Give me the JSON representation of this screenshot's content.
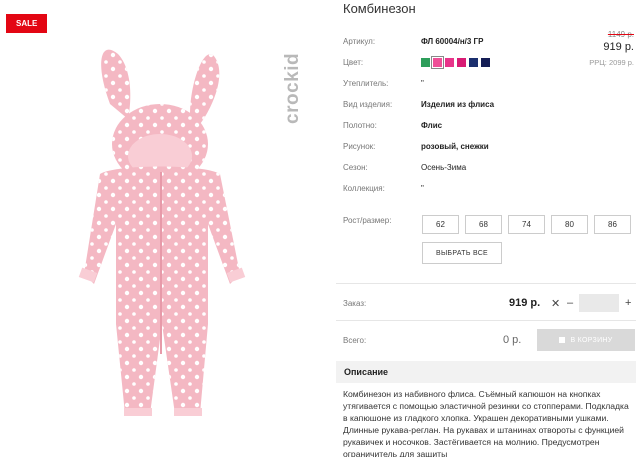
{
  "gallery": {
    "sale_badge": "SALE",
    "brand_logo_text": "crockid"
  },
  "product": {
    "title": "Комбинезон",
    "old_price": "1149 р.",
    "price": "919 р.",
    "rrp": "РРЦ: 2099 р."
  },
  "attributes": [
    {
      "label": "Артикул:",
      "value": "ФЛ 60004/н/3 ГР"
    },
    {
      "label": "Цвет:",
      "value": ""
    },
    {
      "label": "Утеплитель:",
      "value": "\""
    },
    {
      "label": "Вид изделия:",
      "value": "Изделия из флиса"
    },
    {
      "label": "Полотно:",
      "value": "Флис"
    },
    {
      "label": "Рисунок:",
      "value": "розовый, снежки"
    },
    {
      "label": "Сезон:",
      "value": "Осень-Зима"
    },
    {
      "label": "Коллекция:",
      "value": "\""
    }
  ],
  "colors": [
    {
      "name": "green",
      "hex": "#2e9e5b"
    },
    {
      "name": "pink-selected",
      "hex": "#ee4f97"
    },
    {
      "name": "pink",
      "hex": "#e8348a"
    },
    {
      "name": "magenta",
      "hex": "#d81b74"
    },
    {
      "name": "navy",
      "hex": "#1b2f6e"
    },
    {
      "name": "dark-navy",
      "hex": "#141d55"
    }
  ],
  "sizes": {
    "label": "Рост/размер:",
    "options": [
      "62",
      "68",
      "74",
      "80",
      "86"
    ],
    "select_all": "ВЫБРАТЬ ВСЕ"
  },
  "order": {
    "label": "Заказ:",
    "price": "919 р.",
    "remove": "✕",
    "minus": "–",
    "plus": "+"
  },
  "total": {
    "label": "Всего:",
    "price": "0 р.",
    "cart_button": "В КОРЗИНУ"
  },
  "description": {
    "heading": "Описание",
    "text": "Комбинезон из набивного флиса. Съёмный капюшон на кнопках утягивается с помощью эластичной резинки со стопперами. Подкладка в капюшоне из гладкого хлопка. Украшен декоративными ушками. Длинные рукава-реглан. На рукавах и штанинах отвороты с функцией рукавичек и носочков. Застёгивается на молнию. Предусмотрен ограничитель для защиты"
  }
}
